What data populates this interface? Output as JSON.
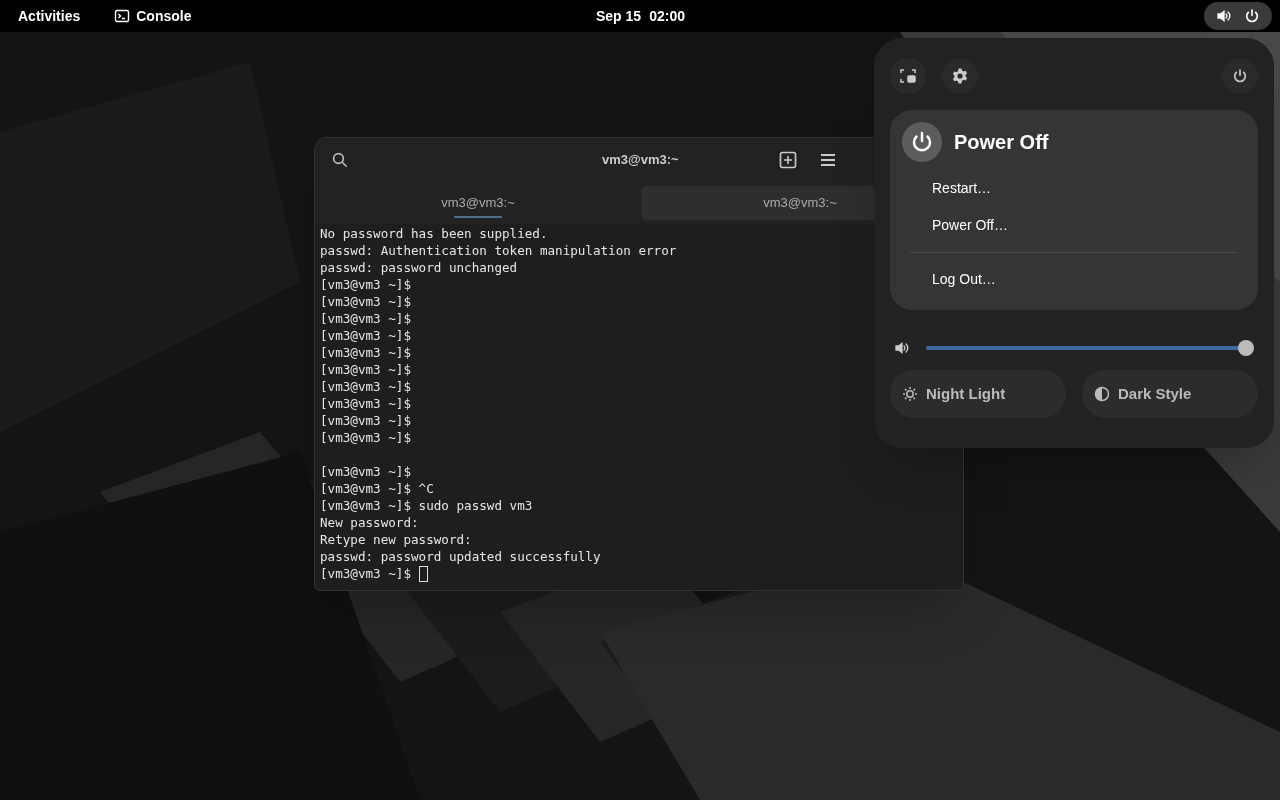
{
  "top_bar": {
    "activities": "Activities",
    "app_name": "Console",
    "date": "Sep 15",
    "time": "02:00",
    "status_menu_open": true
  },
  "terminal": {
    "title": "vm3@vm3:~",
    "tabs": [
      {
        "label": "vm3@vm3:~",
        "selected": true
      },
      {
        "label": "vm3@vm3:~",
        "selected": false
      }
    ],
    "lines": [
      {
        "kind": "output",
        "text": "No password has been supplied."
      },
      {
        "kind": "output",
        "text": "passwd: Authentication token manipulation error"
      },
      {
        "kind": "output",
        "text": "passwd: password unchanged"
      },
      {
        "kind": "output",
        "text": "[vm3@vm3 ~]$"
      },
      {
        "kind": "output",
        "text": "[vm3@vm3 ~]$"
      },
      {
        "kind": "output",
        "text": "[vm3@vm3 ~]$"
      },
      {
        "kind": "output",
        "text": "[vm3@vm3 ~]$"
      },
      {
        "kind": "output",
        "text": "[vm3@vm3 ~]$"
      },
      {
        "kind": "output",
        "text": "[vm3@vm3 ~]$"
      },
      {
        "kind": "output",
        "text": "[vm3@vm3 ~]$"
      },
      {
        "kind": "output",
        "text": "[vm3@vm3 ~]$"
      },
      {
        "kind": "output",
        "text": "[vm3@vm3 ~]$"
      },
      {
        "kind": "output",
        "text": "[vm3@vm3 ~]$"
      },
      {
        "kind": "blank"
      },
      {
        "kind": "output",
        "text": "[vm3@vm3 ~]$"
      },
      {
        "kind": "output",
        "text": "[vm3@vm3 ~]$ ^C"
      },
      {
        "kind": "output",
        "text": "[vm3@vm3 ~]$ sudo passwd vm3"
      },
      {
        "kind": "output",
        "text": "New password:"
      },
      {
        "kind": "output",
        "text": "Retype new password:"
      },
      {
        "kind": "output",
        "text": "passwd: password updated successfully"
      },
      {
        "kind": "prompt",
        "text": "[vm3@vm3 ~]$"
      }
    ],
    "cursor_visible": true
  },
  "quick_settings": {
    "power_menu": {
      "title": "Power Off",
      "items": [
        {
          "kind": "item",
          "label": "Restart…"
        },
        {
          "kind": "item",
          "label": "Power Off…"
        },
        {
          "kind": "separator"
        },
        {
          "kind": "item",
          "label": "Log Out…"
        }
      ]
    },
    "volume": {
      "level": 1.0
    },
    "toggles": [
      {
        "label": "Night Light",
        "on": false
      },
      {
        "label": "Dark Style",
        "on": false
      }
    ]
  }
}
